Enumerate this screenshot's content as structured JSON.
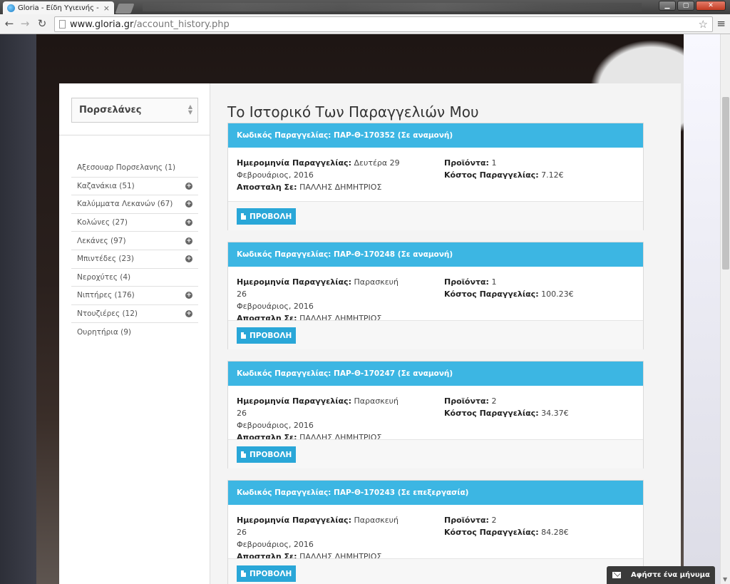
{
  "browser": {
    "tab_title": "Gloria - Είδη Υγιεινής - Μ",
    "tab_close": "×",
    "url_host": "www.gloria.gr",
    "url_path": "/account_history.php",
    "back_icon": "arrow-left",
    "forward_icon": "arrow-right",
    "reload_icon": "reload",
    "star_icon": "star",
    "menu_icon": "hamburger"
  },
  "sidebar": {
    "category_select": "Πορσελάνες",
    "items": [
      {
        "label": "Αξεσουαρ Πορσελανης (1)",
        "expandable": false
      },
      {
        "label": "Καζανάκια (51)",
        "expandable": true
      },
      {
        "label": "Καλύμματα Λεκανών (67)",
        "expandable": true
      },
      {
        "label": "Κολώνες (27)",
        "expandable": true
      },
      {
        "label": "Λεκάνες (97)",
        "expandable": true
      },
      {
        "label": "Μπιντέδες (23)",
        "expandable": true
      },
      {
        "label": "Νεροχύτες (4)",
        "expandable": false
      },
      {
        "label": "Νιπτήρες (176)",
        "expandable": true
      },
      {
        "label": "Ντουζιέρες (12)",
        "expandable": true
      },
      {
        "label": "Ουρητήρια (9)",
        "expandable": false
      }
    ]
  },
  "main": {
    "title": "Το Ιστορικό Των Παραγγελιών Μου",
    "labels": {
      "order_code": "Κωδικός Παραγγελίας:",
      "order_date": "Ημερομηνία Παραγγελίας:",
      "shipped_to": "Αποσταλη Σε:",
      "products": "Προϊόντα:",
      "order_cost": "Κόστος Παραγγελίας:",
      "view_button": "ΠΡΟΒΟΛΗ"
    },
    "orders": [
      {
        "code": "ΠΑΡ-Θ-170352",
        "status": "(Σε αναμονή)",
        "date_line1": "Δευτέρα 29",
        "date_line2": "Φεβρουάριος, 2016",
        "recipient": "ΠΑΛΛΗΣ ΔΗΜΗΤΡΙΟΣ",
        "products": "1",
        "cost": "7.12€"
      },
      {
        "code": "ΠΑΡ-Θ-170248",
        "status": "(Σε αναμονή)",
        "date_line1": "Παρασκευή 26",
        "date_line2": "Φεβρουάριος, 2016",
        "recipient": "ΠΑΛΛΗΣ ΔΗΜΗΤΡΙΟΣ",
        "products": "1",
        "cost": "100.23€"
      },
      {
        "code": "ΠΑΡ-Θ-170247",
        "status": "(Σε αναμονή)",
        "date_line1": "Παρασκευή 26",
        "date_line2": "Φεβρουάριος, 2016",
        "recipient": "ΠΑΛΛΗΣ ΔΗΜΗΤΡΙΟΣ",
        "products": "2",
        "cost": "34.37€"
      },
      {
        "code": "ΠΑΡ-Θ-170243",
        "status": "(Σε επεξεργασία)",
        "date_line1": "Παρασκευή 26",
        "date_line2": "Φεβρουάριος, 2016",
        "recipient": "ΠΑΛΛΗΣ ΔΗΜΗΤΡΙΟΣ",
        "products": "2",
        "cost": "84.28€"
      }
    ]
  },
  "message_widget": {
    "label": "Αφήστε ένα μήνυμα",
    "icon": "envelope"
  },
  "colors": {
    "order_header": "#3cb6e3",
    "view_button": "#2aa7d8",
    "widget_bg": "#3a3a3a"
  }
}
